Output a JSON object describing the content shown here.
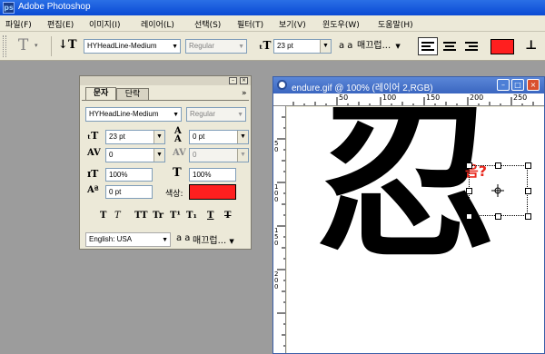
{
  "app": {
    "title": "Adobe Photoshop",
    "logo_text": "ps"
  },
  "menu": [
    "파일(F)",
    "편집(E)",
    "이미지(I)",
    "레이어(L)",
    "선택(S)",
    "필터(T)",
    "보기(V)",
    "윈도우(W)",
    "도움말(H)"
  ],
  "options_bar": {
    "tool_icon": "text-tool-icon",
    "font_family": "HYHeadLine-Medium",
    "font_style": "Regular",
    "font_size": "23 pt",
    "anti_alias_label": "a a",
    "anti_alias": "매끄럽...",
    "text_color": "#ff1f1f"
  },
  "character_panel": {
    "tabs": [
      "문자",
      "단락"
    ],
    "font_family": "HYHeadLine-Medium",
    "font_style": "Regular",
    "font_size": "23 pt",
    "leading": "0 pt",
    "kerning": "0",
    "tracking": "0",
    "vertical_scale": "100%",
    "horizontal_scale": "100%",
    "baseline_shift": "0 pt",
    "color_label": "색상:",
    "color": "#ff1f1f",
    "format_buttons": [
      "T",
      "T",
      "TT",
      "Tr",
      "T¹",
      "T₁",
      "T",
      "T"
    ],
    "language": "English: USA",
    "anti_alias_label": "a a",
    "anti_alias": "매끄럽..."
  },
  "document": {
    "title": "endure.gif @ 100% (레이어 2,RGB)",
    "ruler_h_labels": [
      "50",
      "100",
      "150",
      "200",
      "250"
    ],
    "ruler_v_labels": [
      "5",
      "0",
      "1",
      "0",
      "0",
      "1",
      "5",
      "0",
      "2",
      "0",
      "0"
    ],
    "main_glyph": "忍",
    "overlay_text": "음?",
    "overlay_color": "#e8281e",
    "glyph_color": "#000000"
  }
}
